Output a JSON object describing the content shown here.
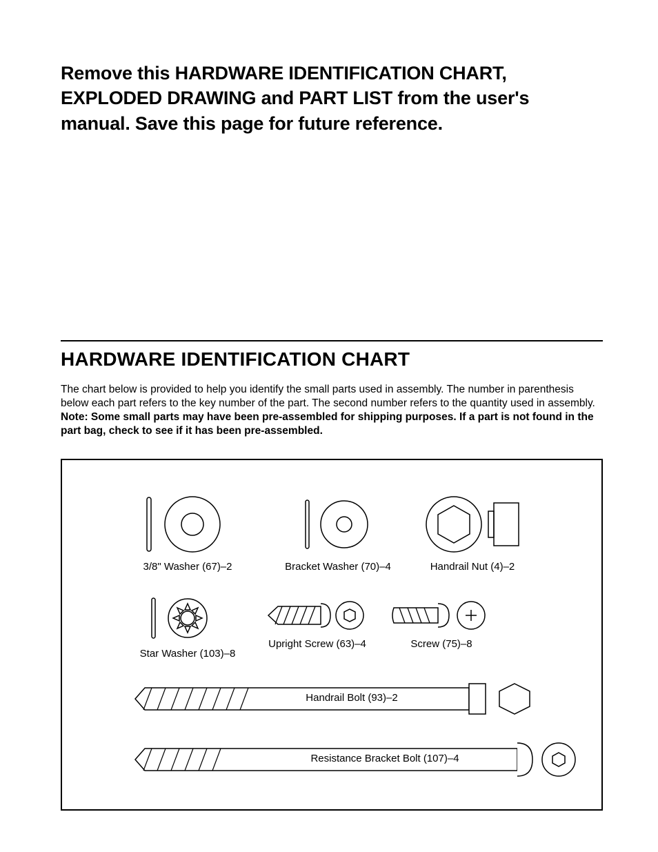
{
  "intro": "Remove this HARDWARE IDENTIFICATION CHART, EXPLODED DRAWING and PART LIST from the user's manual. Save this page for future reference.",
  "section_title": "HARDWARE IDENTIFICATION CHART",
  "description_plain": "The chart below is provided to help you identify the small parts used in assembly. The number in parenthesis below each part refers to the key number of the part. The second number refers to the quantity used in assembly. ",
  "description_bold": "Note: Some small parts may have been pre-assembled for shipping purposes. If a part is not found in the part bag, check to see if it has been pre-assembled.",
  "parts": {
    "washer_38": "3/8\" Washer (67)–2",
    "bracket_washer": "Bracket Washer (70)–4",
    "handrail_nut": "Handrail Nut (4)–2",
    "star_washer": "Star Washer (103)–8",
    "upright_screw": "Upright Screw (63)–4",
    "screw": "Screw (75)–8",
    "handrail_bolt": "Handrail Bolt (93)–2",
    "resistance_bolt": "Resistance Bracket Bolt (107)–4"
  }
}
